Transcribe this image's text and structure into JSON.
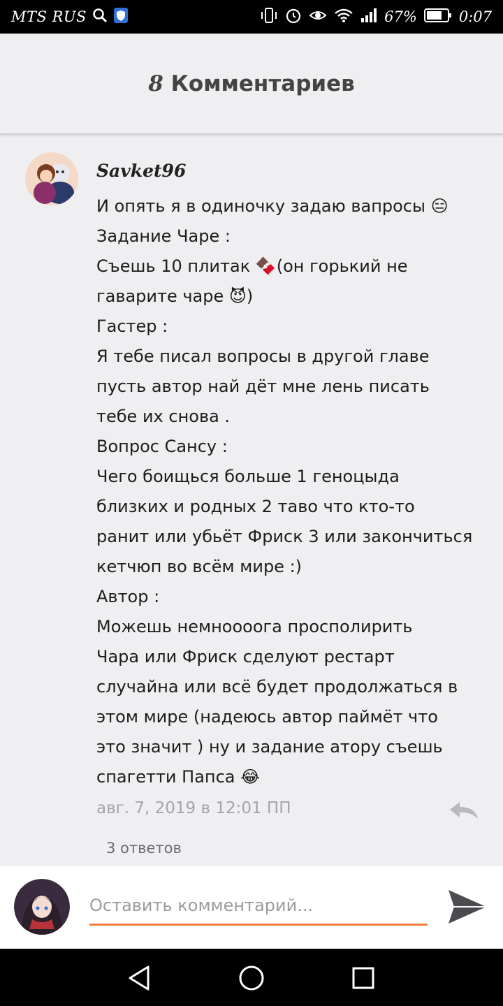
{
  "status_bar": {
    "carrier": "MTS RUS",
    "battery": "67%",
    "time": "0:07",
    "icons": [
      "search-icon",
      "shield-icon",
      "vibrate-icon",
      "alarm-icon",
      "eye-icon",
      "wifi-icon",
      "signal-icon",
      "battery-icon"
    ]
  },
  "header": {
    "count": "8",
    "title": "Комментариев"
  },
  "comment": {
    "author": "Savket96",
    "lines": [
      "И опять я в одиночку задаю вапросы 😑",
      "Задание Чаре :",
      "Съешь 10 плитак 🍫(он горький не",
      "гаварите чаре 😈)",
      "Гастер :",
      "Я тебе писал вопросы в другой главе",
      "пусть автор най дёт мне лень писать",
      "тебе их снова .",
      "Вопрос Сансу :",
      "Чего боищься больше 1 геноцыда",
      "близких и родных 2 таво что кто-то",
      "ранит или убьёт Фриск 3 или закончиться",
      "кетчюп во всём мире :)",
      "Автор :",
      "Можешь немноооога просполирить",
      "Чара или Фриск сделуют рестарт",
      "случайна или всё будет продолжаться в",
      "этом мире (надеюсь автор паймёт что",
      "это значит ) ну и задание атору съешь",
      "спагетти Папса 😂"
    ],
    "timestamp": "авг. 7, 2019 в 12:01 ПП",
    "replies": "3 ответов"
  },
  "input": {
    "placeholder": "Оставить комментарий...",
    "value": ""
  },
  "colors": {
    "accent": "#f27b3b",
    "background": "#efeef1"
  },
  "nav": {
    "icons": [
      "back-icon",
      "home-icon",
      "recents-icon"
    ]
  }
}
